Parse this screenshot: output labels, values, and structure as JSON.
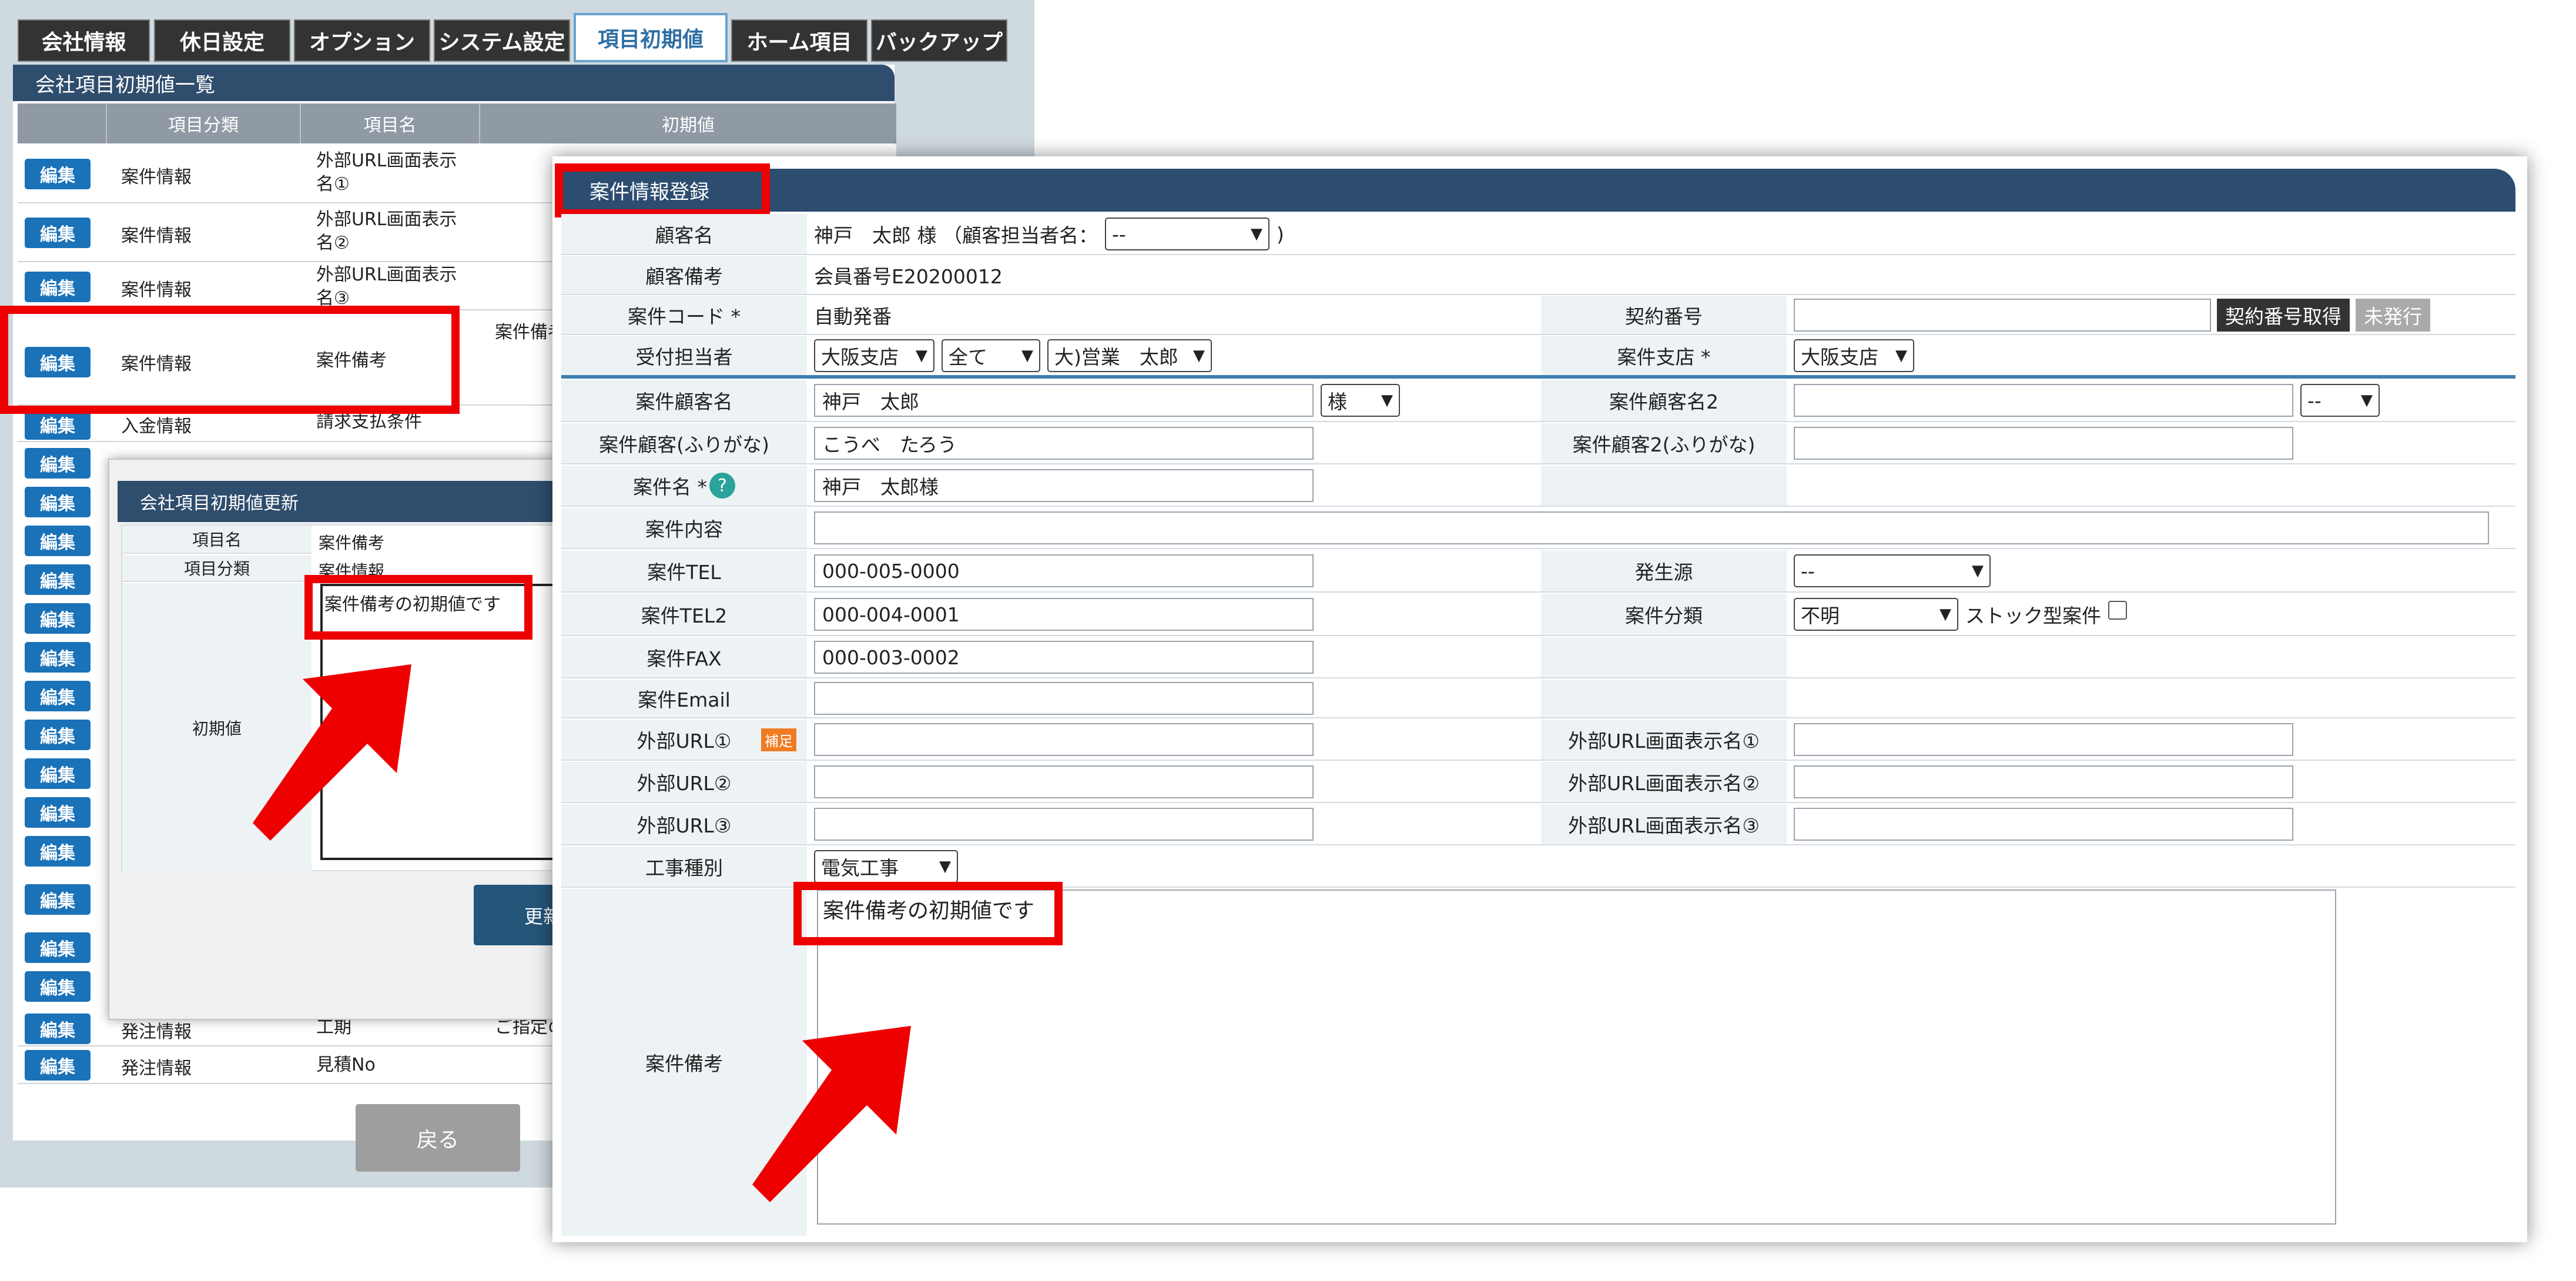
{
  "tabs": [
    "会社情報",
    "休日設定",
    "オプション",
    "システム設定",
    "項目初期値",
    "ホーム項目",
    "バックアップ"
  ],
  "active_tab": "項目初期値",
  "list": {
    "title": "会社項目初期値一覧",
    "headers": [
      "項目分類",
      "項目名",
      "初期値"
    ],
    "edit_label": "編集",
    "rows": [
      {
        "cat": "案件情報",
        "name": "外部URL画面表示名①",
        "val": ""
      },
      {
        "cat": "案件情報",
        "name": "外部URL画面表示名②",
        "val": ""
      },
      {
        "cat": "案件情報",
        "name": "外部URL画面表示名③",
        "val": ""
      },
      {
        "cat": "案件情報",
        "name": "案件備考",
        "val": "案件備考"
      },
      {
        "cat": "入金情報",
        "name": "請求支払条件",
        "val": ""
      },
      {
        "cat": "発注情報",
        "name": "工期",
        "val": "ご指定の"
      },
      {
        "cat": "発注情報",
        "name": "見積No",
        "val": ""
      }
    ],
    "back_label": "戻る"
  },
  "dialog": {
    "title": "会社項目初期値更新",
    "name_label": "項目名",
    "name_value": "案件備考",
    "cat_label": "項目分類",
    "cat_value": "案件情報",
    "init_label": "初期値",
    "init_value": "案件備考の初期値です",
    "update_label": "更新"
  },
  "main": {
    "title": "案件情報登録",
    "customer_label": "顧客名",
    "customer_value": "神戸　太郎 様 （顧客担当者名：",
    "customer_contact_select": "--",
    "customer_close": ")",
    "customer_note_label": "顧客備考",
    "customer_note_value": "会員番号E20200012",
    "code_label": "案件コード *",
    "code_value": "自動発番",
    "contract_label": "契約番号",
    "contract_btn": "契約番号取得",
    "contract_status": "未発行",
    "reception_label": "受付担当者",
    "reception_branch": "大阪支店",
    "reception_all": "全て",
    "reception_person": "大)営業　太郎",
    "branch_label": "案件支店 *",
    "branch_value": "大阪支店",
    "case_customer_label": "案件顧客名",
    "case_customer_value": "神戸　太郎",
    "honorific": "様",
    "case_customer2_label": "案件顧客名2",
    "case_customer2_select": "--",
    "kana_label": "案件顧客(ふりがな)",
    "kana_value": "こうべ　たろう",
    "kana2_label": "案件顧客2(ふりがな)",
    "case_name_label": "案件名 *",
    "case_name_value": "神戸　太郎様",
    "content_label": "案件内容",
    "tel_label": "案件TEL",
    "tel_value": "000-005-0000",
    "source_label": "発生源",
    "source_value": "--",
    "tel2_label": "案件TEL2",
    "tel2_value": "000-004-0001",
    "class_label": "案件分類",
    "class_value": "不明",
    "stock_label": "ストック型案件",
    "fax_label": "案件FAX",
    "fax_value": "000-003-0002",
    "email_label": "案件Email",
    "url1_label": "外部URL①",
    "hosoku": "補足",
    "url1_disp_label": "外部URL画面表示名①",
    "url2_label": "外部URL②",
    "url2_disp_label": "外部URL画面表示名②",
    "url3_label": "外部URL③",
    "url3_disp_label": "外部URL画面表示名③",
    "work_label": "工事種別",
    "work_value": "電気工事",
    "memo_label": "案件備考",
    "memo_value": "案件備考の初期値です"
  },
  "colors": {
    "highlight": "#ee0000",
    "header": "#2c4d70",
    "edit_button": "#1a72b8"
  }
}
